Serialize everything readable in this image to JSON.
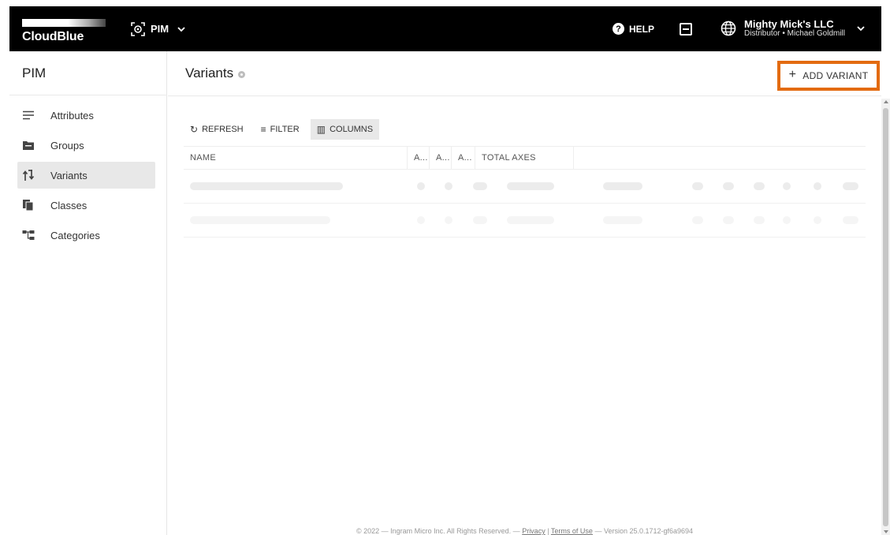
{
  "brand": {
    "name": "CloudBlue"
  },
  "header": {
    "module_label": "PIM",
    "help_label": "HELP",
    "account_name": "Mighty Mick's LLC",
    "account_role": "Distributor • Michael Goldmill"
  },
  "sidebar": {
    "title": "PIM",
    "items": [
      {
        "label": "Attributes",
        "icon": "list-lines-icon"
      },
      {
        "label": "Groups",
        "icon": "folder-icon"
      },
      {
        "label": "Variants",
        "icon": "variants-icon",
        "active": true
      },
      {
        "label": "Classes",
        "icon": "copy-icon"
      },
      {
        "label": "Categories",
        "icon": "hierarchy-icon"
      }
    ]
  },
  "main": {
    "title": "Variants",
    "add_button_label": "ADD VARIANT",
    "toolbar": {
      "refresh_label": "REFRESH",
      "filter_label": "FILTER",
      "columns_label": "COLUMNS"
    },
    "table": {
      "columns": [
        "NAME",
        "A...",
        "A...",
        "A...",
        "TOTAL AXES"
      ]
    }
  },
  "footer": {
    "copyright": "© 2022 — Ingram Micro Inc. All Rights Reserved. —",
    "privacy": "Privacy",
    "separator": "|",
    "terms": "Terms of Use",
    "version": "— Version 25.0.1712-gf6a9694"
  },
  "colors": {
    "topbar_bg": "#000000",
    "highlight": "#e36b10",
    "active_bg": "#e8e8e8"
  }
}
